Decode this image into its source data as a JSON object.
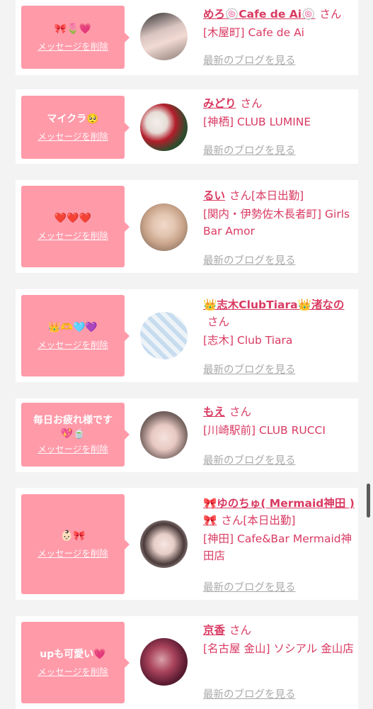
{
  "delete_label": "メッセージを削除",
  "blog_label": "最新のブログを見る",
  "honorific": "さん",
  "colors": {
    "accent": "#d93a62",
    "bubble": "#ff9aa9",
    "background": "#f3f3f3",
    "muted": "#aaaaaa"
  },
  "items": [
    {
      "message": "🎀🌷💗",
      "name": "めろ🍥Cafe de Ai🍥",
      "shop": "[木屋町] Cafe de Ai"
    },
    {
      "message": "マイクラ🥺",
      "name": "みどり",
      "shop": "[神栖] CLUB LUMINE"
    },
    {
      "message": "❤️❤️❤️",
      "name": "るい",
      "status": "[本日出勤]",
      "shop": "[関内・伊勢佐木長者町] Girls Bar Amor"
    },
    {
      "message": "👑🫶🩵💜",
      "name": "👑志木ClubTiara👑渚なの",
      "shop": "[志木] Club Tiara"
    },
    {
      "message": "毎日お疲れ様です💖🍵",
      "name": "もえ",
      "shop": "[川崎駅前] CLUB RUCCI"
    },
    {
      "message": "👶🏻🎀",
      "name": "🎀ゆのちゅ( Mermaid神田 )🎀",
      "status": "[本日出勤]",
      "shop": "[神田] Cafe&Bar Mermaid神田店"
    },
    {
      "message": "upも可愛い💗",
      "name": "京香",
      "shop": "[名古屋 金山] ソシアル 金山店"
    }
  ]
}
